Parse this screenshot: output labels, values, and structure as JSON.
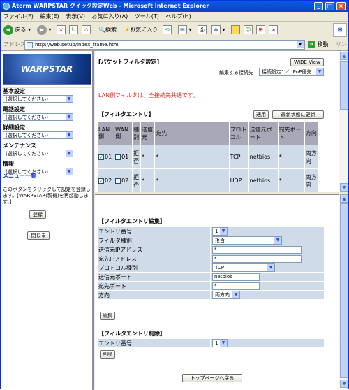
{
  "window": {
    "title": "Aterm WARPSTAR クイック設定Web - Microsoft Internet Explorer",
    "min": "_",
    "max": "□",
    "close": "×"
  },
  "menubar": [
    "ファイル(F)",
    "編集(E)",
    "表示(V)",
    "お気に入り(A)",
    "ツール(T)",
    "ヘルプ(H)"
  ],
  "toolbar": {
    "back": "戻る",
    "search": "検索",
    "favorites": "お気に入り"
  },
  "address": {
    "label": "アドレス(D)",
    "url": "http://web.setup/index_frame.html",
    "go": "移動",
    "links": "リンク"
  },
  "sidebar": {
    "logo": "WARPSTAR",
    "groups": [
      {
        "title": "基本設定",
        "select": "(選択してください)"
      },
      {
        "title": "電話設定",
        "select": "(選択してください)"
      },
      {
        "title": "詳細設定",
        "select": "(選択してください)"
      },
      {
        "title": "メンテナンス",
        "select": "(選択してください)"
      },
      {
        "title": "情報",
        "select": "(選択してください)"
      }
    ],
    "menu_all": "メニュー一覧",
    "note": "このボタンをクリックして設定を登録します。[WARPSTAR(親機)を再起動します。]",
    "register": "登録",
    "close": "閉じる"
  },
  "upper": {
    "title": "[パケットフィルタ設定]",
    "wide_view": "WIDE View",
    "conn_label": "編集する接続先",
    "conn_value": "接続設定1／UPnP優先",
    "notice": "LAN側フィルタは、全接続先共通です。",
    "entry_title": "【フィルタエントリ】",
    "apply": "適用",
    "refresh": "最新状態に更新",
    "headers": [
      "LAN側",
      "WAN側",
      "種別",
      "送信元",
      "宛先",
      "プロトコル",
      "送信元ポート",
      "宛先ポート",
      "方向"
    ],
    "rows": [
      {
        "lan": "01",
        "wan": "01",
        "type": "拒否",
        "src": "*",
        "dst": "*",
        "proto": "TCP",
        "sport": "netbios",
        "dport": "*",
        "dir": "両方向"
      },
      {
        "lan": "02",
        "wan": "02",
        "type": "拒否",
        "src": "*",
        "dst": "*",
        "proto": "UDP",
        "sport": "netbios",
        "dport": "*",
        "dir": "両方向"
      }
    ]
  },
  "edit": {
    "title": "【フィルタエントリ編集】",
    "fields": {
      "entry_no": {
        "label": "エントリ番号",
        "value": "1"
      },
      "filter_type": {
        "label": "フィルタ種別",
        "value": "拒否"
      },
      "src_ip": {
        "label": "送信元IPアドレス",
        "value": "*"
      },
      "dst_ip": {
        "label": "宛先IPアドレス",
        "value": "*"
      },
      "protocol": {
        "label": "プロトコル種別",
        "value": "TCP"
      },
      "src_port": {
        "label": "送信元ポート",
        "value": "netbios"
      },
      "dst_port": {
        "label": "宛先ポート",
        "value": "*"
      },
      "direction": {
        "label": "方向",
        "value": "両方向"
      }
    },
    "button": "編集"
  },
  "delete": {
    "title": "【フィルタエントリ削除】",
    "entry_label": "エントリ番号",
    "entry_value": "1",
    "button": "削除"
  },
  "top_button": "トップページへ戻る"
}
